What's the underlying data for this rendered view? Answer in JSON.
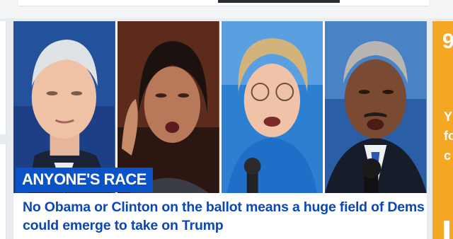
{
  "story": {
    "badge": "ANYONE'S RACE",
    "headline": "No Obama or Clinton on the ballot means a huge field of Dems could emerge to take on Trump"
  },
  "side": {
    "letters": [
      "Y",
      "fo",
      "c"
    ],
    "glyph": "9"
  },
  "colors": {
    "accent_blue": "#0a52c7",
    "headline_blue": "#0a47b8",
    "side_orange": "#f5a623"
  }
}
